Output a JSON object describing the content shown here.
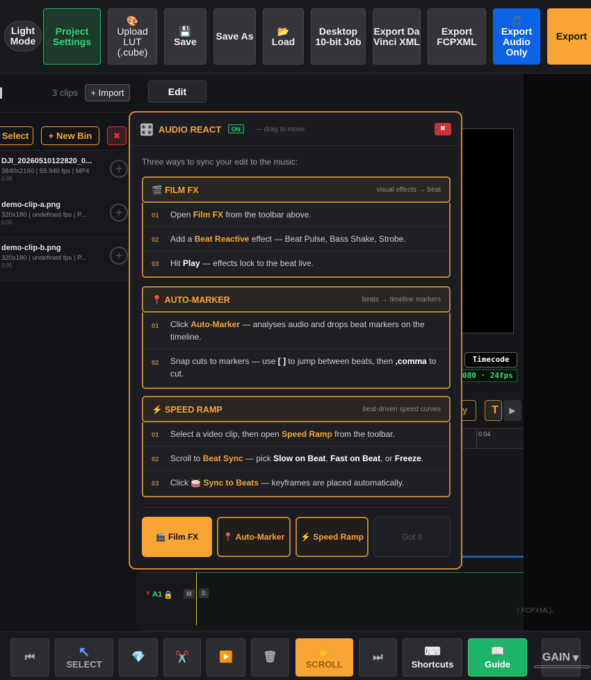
{
  "toolbar": {
    "light_mode": "Light Mode",
    "project_settings": "Project Settings",
    "upload_lut_icon": "🎨",
    "upload_lut": "Upload LUT (.cube)",
    "save_icon": "💾",
    "save": "Save",
    "save_as": "Save As",
    "load_icon": "📂",
    "load": "Load",
    "desktop_job": "Desktop 10-bit Job",
    "export_davinci": "Export Da Vinci XML",
    "export_fcpxml": "Export FCPXML",
    "export_audio_icon": "🎵",
    "export_audio": "Export Audio Only",
    "export": "Export"
  },
  "media": {
    "clips_count": "3 clips",
    "import": "+ Import",
    "select": "Select",
    "new_bin": "+ New Bin",
    "delete_icon": "✖",
    "clips": [
      {
        "name": "DJI_20260510122820_0...",
        "meta": "3840x2160 | 59.940 fps | MP4",
        "duration": "0:39"
      },
      {
        "name": "demo-clip-a.png",
        "meta": "320x180 | undefined fps | P...",
        "duration": "0:05"
      },
      {
        "name": "demo-clip-b.png",
        "meta": "320x180 | undefined fps | P...",
        "duration": "0:05"
      }
    ]
  },
  "editor": {
    "edit_tab": "Edit",
    "timecode": "Timecode",
    "timecode_value": "080 · 24fps",
    "ruler_label": "0:04",
    "track_label": "A1",
    "mute": "M",
    "solo": "S",
    "track_hint": "/ FCPXML),"
  },
  "modal": {
    "title_icon": "🎛️",
    "title": "AUDIO REACT",
    "badge": "ON",
    "drag_hint": "— drag to move",
    "close_icon": "✖",
    "intro": "Three ways to sync your edit to the music:",
    "film_fx": {
      "title": "🎬 FILM FX",
      "tag": "visual effects → beat",
      "steps": [
        {
          "num": "01",
          "a": "Open ",
          "b": "Film FX",
          "c": " from the toolbar above."
        },
        {
          "num": "02",
          "a": "Add a ",
          "b": "Beat Reactive",
          "c": " effect — Beat Pulse, Bass Shake, Strobe."
        },
        {
          "num": "03",
          "a": "Hit ",
          "b": "Play",
          "c": " — effects lock to the beat live."
        }
      ]
    },
    "auto_marker": {
      "title": "📍 AUTO-MARKER",
      "tag": "beats → timeline markers",
      "step1": {
        "num": "01",
        "a": "Click ",
        "b": "Auto-Marker",
        "c": " — analyses audio and drops beat markers on the timeline."
      },
      "step2": {
        "num": "02",
        "a": "Snap cuts to markers — use ",
        "b": "[ ]",
        "c": " to jump between beats, then ",
        "d": ",comma",
        "e": " to cut."
      }
    },
    "speed_ramp": {
      "title": "⚡ SPEED RAMP",
      "tag": "beat-driven speed curves",
      "step1": {
        "num": "01",
        "a": "Select a video clip, then open ",
        "b": "Speed Ramp",
        "c": " from the toolbar."
      },
      "step2": {
        "num": "02",
        "a": "Scroll to ",
        "b": "Beat Sync",
        "c": " — pick ",
        "d": "Slow on Beat",
        "e": ", ",
        "f": "Fast on Beat",
        "g": ", or ",
        "h": "Freeze",
        "i": "."
      },
      "step3": {
        "num": "03",
        "a": "Click ",
        "icon": "🥁",
        "b": " Sync to Beats",
        "c": " — keyframes are placed automatically."
      }
    },
    "buttons": {
      "film_fx": "🎬 Film FX",
      "auto_marker": "📍 Auto-Marker",
      "speed_ramp": "⚡ Speed Ramp",
      "got_it": "Got it"
    }
  },
  "bottombar": {
    "prev_icon": "⏮",
    "select_icon": "↖",
    "select": "SELECT",
    "gem_icon": "💎",
    "cut_icon": "✂️",
    "play_icon": "▶️",
    "trash_icon": "🗑",
    "scroll_icon": "✋",
    "scroll": "SCROLL",
    "next_icon": "⏭",
    "shortcuts_icon": "⌨",
    "shortcuts": "Shortcuts",
    "guide_icon": "📖",
    "guide": "Guide",
    "gain": "GAIN",
    "gain_caret": "▾"
  },
  "colors": {
    "accent": "#f7a533",
    "green": "#1fb36a",
    "blue": "#0c63e6",
    "danger": "#d9333a"
  }
}
